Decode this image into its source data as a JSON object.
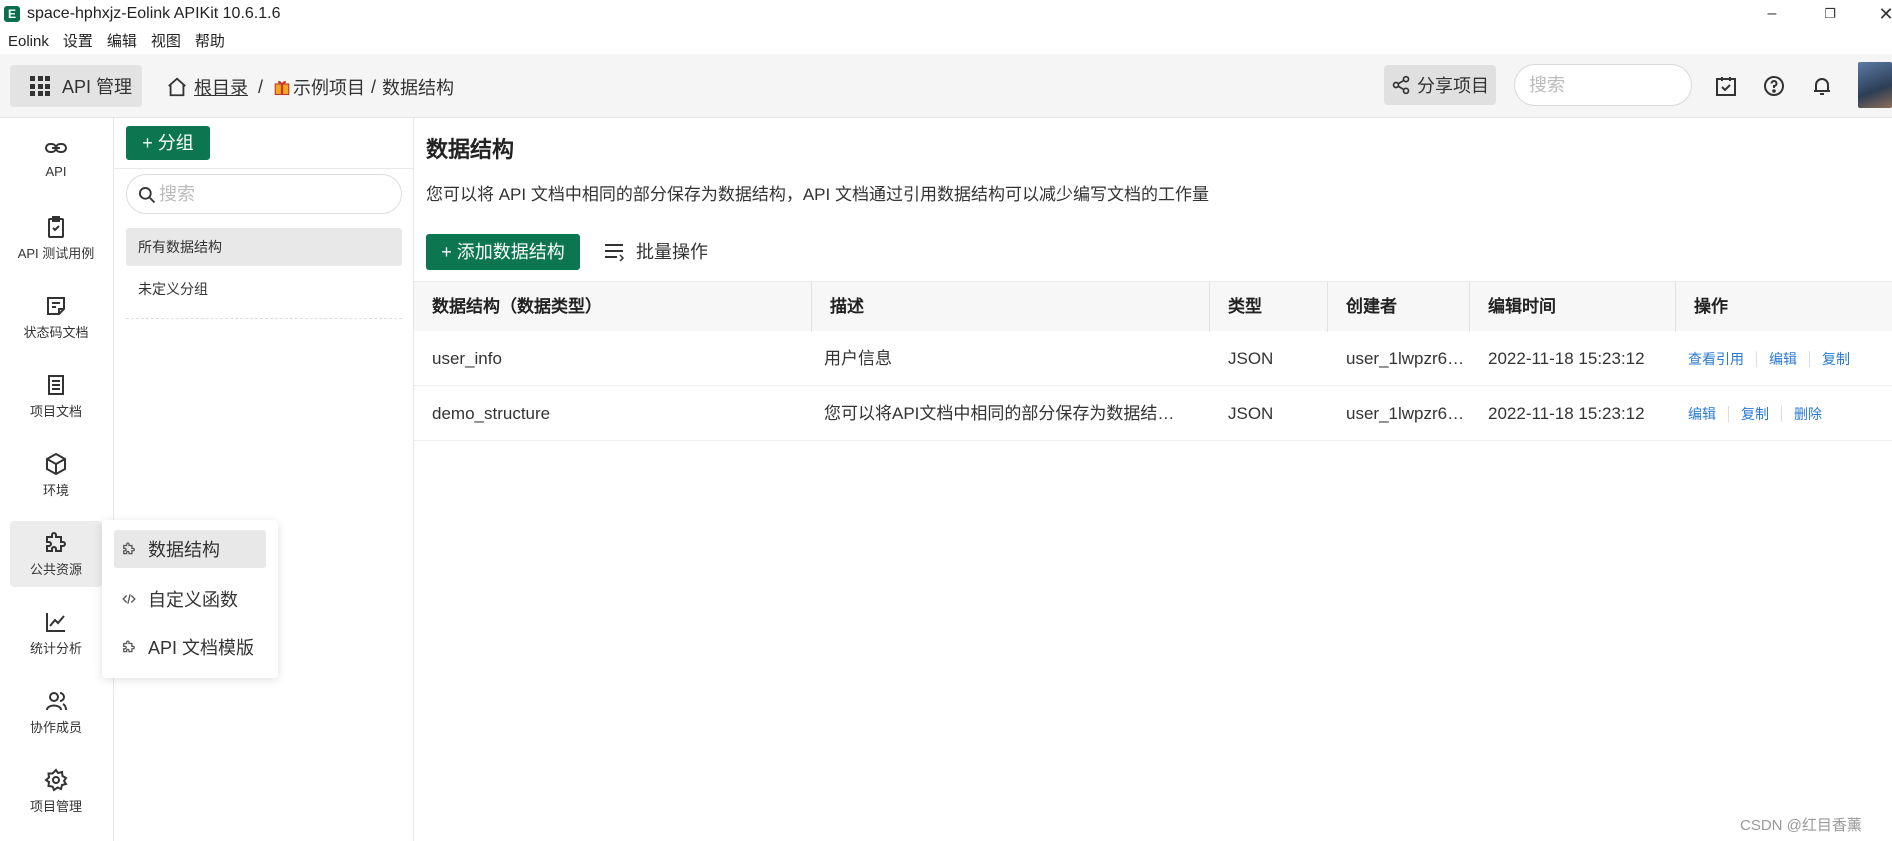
{
  "window": {
    "title": "space-hphxjz-Eolink APIKit 10.6.1.6",
    "logo": "E",
    "minimize": "–",
    "maximize": "❐",
    "close": "✕"
  },
  "menu": [
    "Eolink",
    "设置",
    "编辑",
    "视图",
    "帮助"
  ],
  "toolbar": {
    "app_label": "API 管理",
    "breadcrumb": {
      "root": "根目录",
      "sep": "/",
      "project": "示例项目",
      "sep2": "/",
      "current": "数据结构"
    },
    "share_label": "分享项目",
    "search_placeholder": "搜索"
  },
  "nav": [
    {
      "label": "API",
      "icon": "link-icon"
    },
    {
      "label": "API 测试用例",
      "icon": "clipboard-check-icon"
    },
    {
      "label": "状态码文档",
      "icon": "note-icon"
    },
    {
      "label": "项目文档",
      "icon": "document-icon"
    },
    {
      "label": "环境",
      "icon": "cube-icon"
    },
    {
      "label": "公共资源",
      "icon": "puzzle-icon",
      "active": true
    },
    {
      "label": "统计分析",
      "icon": "chart-line-icon"
    },
    {
      "label": "协作成员",
      "icon": "users-icon"
    },
    {
      "label": "项目管理",
      "icon": "gear-icon"
    }
  ],
  "groups": {
    "add_label": "+ 分组",
    "search_placeholder": "搜索",
    "items": [
      "所有数据结构",
      "未定义分组"
    ]
  },
  "popover": {
    "items": [
      "数据结构",
      "自定义函数",
      "API 文档模版"
    ]
  },
  "main": {
    "title": "数据结构",
    "description": "您可以将 API 文档中相同的部分保存为数据结构，API 文档通过引用数据结构可以减少编写文档的工作量",
    "add_label": "+ 添加数据结构",
    "batch_label": "批量操作",
    "columns": [
      "数据结构（数据类型）",
      "描述",
      "类型",
      "创建者",
      "编辑时间",
      "操作"
    ],
    "rows": [
      {
        "name": "user_info",
        "desc": "用户信息",
        "type": "JSON",
        "creator": "user_1lwpzr6…",
        "time": "2022-11-18 15:23:12",
        "ops": [
          "查看引用",
          "编辑",
          "复制"
        ]
      },
      {
        "name": "demo_structure",
        "desc": "您可以将API文档中相同的部分保存为数据结…",
        "type": "JSON",
        "creator": "user_1lwpzr6…",
        "time": "2022-11-18 15:23:12",
        "ops": [
          "编辑",
          "复制",
          "删除"
        ]
      }
    ]
  },
  "watermark": "CSDN @红目香薰",
  "colors": {
    "brand_green": "#0b7650",
    "link_blue": "#2a7ad4"
  }
}
